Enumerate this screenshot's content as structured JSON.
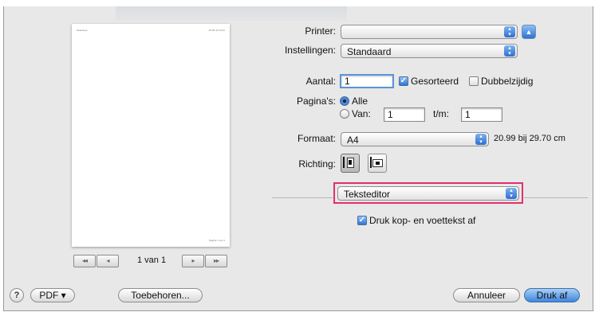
{
  "preview": {
    "header_left": "Naamloos",
    "header_right": "25-06-10 13:42",
    "footer": "Pagina 1 van 1",
    "nav": {
      "first": "◂◂",
      "prev": "◂",
      "next": "▸",
      "last": "▸▸",
      "page_label": "1 van 1"
    }
  },
  "form": {
    "printer_label": "Printer:",
    "printer_value": "",
    "instellingen_label": "Instellingen:",
    "instellingen_value": "Standaard",
    "aantal_label": "Aantal:",
    "aantal_value": "1",
    "gesorteerd_label": "Gesorteerd",
    "gesorteerd_checked": true,
    "dubbelzijdig_label": "Dubbelzijdig",
    "dubbelzijdig_checked": false,
    "paginas_label": "Pagina's:",
    "alle_label": "Alle",
    "van_label": "Van:",
    "van_value": "1",
    "tm_label": "t/m:",
    "tm_value": "1",
    "formaat_label": "Formaat:",
    "formaat_value": "A4",
    "formaat_size": "20.99 bij 29.70 cm",
    "richting_label": "Richting:",
    "section_value": "Teksteditor",
    "druk_kop_label": "Druk kop- en voettekst af",
    "druk_kop_checked": true
  },
  "buttons": {
    "help": "?",
    "pdf": "PDF ▾",
    "toebehoren": "Toebehoren...",
    "annuleer": "Annuleer",
    "druk_af": "Druk af"
  },
  "colors": {
    "highlight": "#e0306f",
    "accent": "#3173d3"
  }
}
